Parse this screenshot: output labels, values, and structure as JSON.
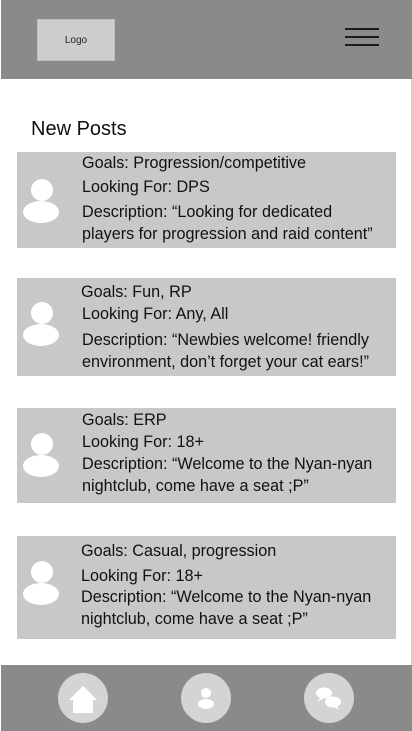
{
  "header": {
    "logo_text": "Logo",
    "menu_icon": "hamburger-menu-icon"
  },
  "section_title": "New Posts",
  "posts": [
    {
      "goals": "Goals: Progression/competitive",
      "looking_for": "Looking For: DPS",
      "description_line1": "Description: “Looking for dedicated",
      "description_line2": "players for progression and raid content”"
    },
    {
      "goals": "Goals: Fun, RP",
      "looking_for": "Looking For: Any, All",
      "description_line1": "Description: “Newbies welcome! friendly",
      "description_line2": "environment, don’t forget your cat ears!”"
    },
    {
      "goals": "Goals: ERP",
      "looking_for": "Looking For: 18+",
      "description_line1": "Description: “Welcome to the Nyan-nyan",
      "description_line2": "nightclub, come have a seat ;P”"
    },
    {
      "goals": "Goals: Casual, progression",
      "looking_for": "Looking For: 18+",
      "description_line1": "Description: “Welcome to the Nyan-nyan",
      "description_line2": "nightclub, come have a seat ;P”"
    }
  ],
  "bottom_nav": {
    "items": [
      {
        "icon": "home-icon"
      },
      {
        "icon": "profile-icon"
      },
      {
        "icon": "chat-icon"
      }
    ]
  },
  "colors": {
    "header_bg": "#8a8a8a",
    "card_bg": "#c8c8c8",
    "nav_button_bg": "#d4d4d4"
  }
}
